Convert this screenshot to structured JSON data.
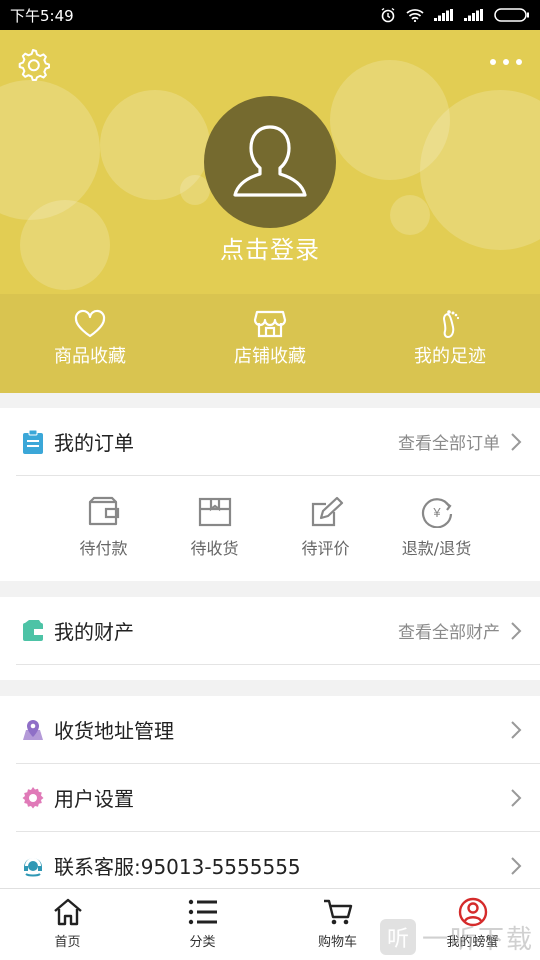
{
  "status_bar": {
    "time": "下午5:49"
  },
  "header": {
    "login_text": "点击登录",
    "quick_links": [
      {
        "label": "商品收藏",
        "icon": "heart-icon"
      },
      {
        "label": "店铺收藏",
        "icon": "store-icon"
      },
      {
        "label": "我的足迹",
        "icon": "footprint-icon"
      }
    ]
  },
  "orders": {
    "title": "我的订单",
    "view_all": "查看全部订单",
    "statuses": [
      {
        "label": "待付款",
        "icon": "wallet-icon"
      },
      {
        "label": "待收货",
        "icon": "package-icon"
      },
      {
        "label": "待评价",
        "icon": "edit-icon"
      },
      {
        "label": "退款/退货",
        "icon": "refund-icon"
      }
    ]
  },
  "assets": {
    "title": "我的财产",
    "view_all": "查看全部财产"
  },
  "menu": {
    "address": "收货地址管理",
    "settings": "用户设置",
    "service": "联系客服:95013-5555555"
  },
  "tabbar": {
    "items": [
      {
        "label": "首页",
        "icon": "home-icon"
      },
      {
        "label": "分类",
        "icon": "list-icon"
      },
      {
        "label": "购物车",
        "icon": "cart-icon"
      },
      {
        "label": "我的螃蟹",
        "icon": "user-circle-icon"
      }
    ],
    "active_index": 3
  },
  "watermark": {
    "icon_char": "听",
    "text": "一听下载"
  },
  "colors": {
    "header_bg": "#e2cd53",
    "quick_bar_bg": "#d9c450",
    "avatar_bg": "#756a2f",
    "active_tab": "#d52b2b"
  }
}
